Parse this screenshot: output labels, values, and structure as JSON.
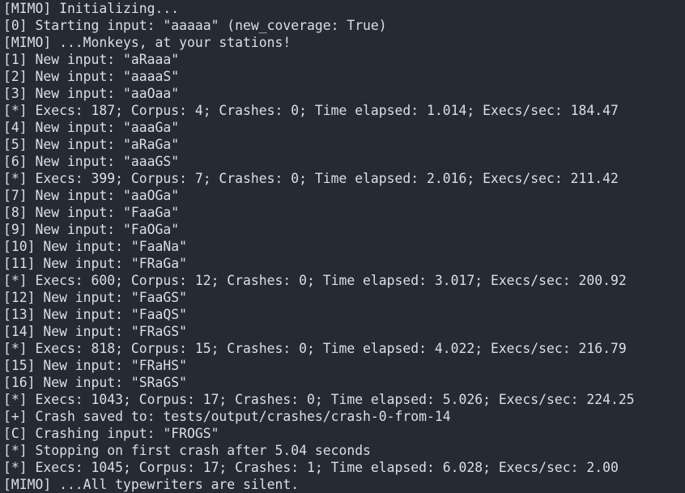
{
  "terminal": {
    "lines": [
      "[MIMO] Initializing...",
      "[0] Starting input: \"aaaaa\" (new_coverage: True)",
      "[MIMO] ...Monkeys, at your stations!",
      "[1] New input: \"aRaaa\"",
      "[2] New input: \"aaaaS\"",
      "[3] New input: \"aaOaa\"",
      "[*] Execs: 187; Corpus: 4; Crashes: 0; Time elapsed: 1.014; Execs/sec: 184.47",
      "[4] New input: \"aaaGa\"",
      "[5] New input: \"aRaGa\"",
      "[6] New input: \"aaaGS\"",
      "[*] Execs: 399; Corpus: 7; Crashes: 0; Time elapsed: 2.016; Execs/sec: 211.42",
      "[7] New input: \"aaOGa\"",
      "[8] New input: \"FaaGa\"",
      "[9] New input: \"FaOGa\"",
      "[10] New input: \"FaaNa\"",
      "[11] New input: \"FRaGa\"",
      "[*] Execs: 600; Corpus: 12; Crashes: 0; Time elapsed: 3.017; Execs/sec: 200.92",
      "[12] New input: \"FaaGS\"",
      "[13] New input: \"FaaQS\"",
      "[14] New input: \"FRaGS\"",
      "[*] Execs: 818; Corpus: 15; Crashes: 0; Time elapsed: 4.022; Execs/sec: 216.79",
      "[15] New input: \"FRaHS\"",
      "[16] New input: \"SRaGS\"",
      "[*] Execs: 1043; Corpus: 17; Crashes: 0; Time elapsed: 5.026; Execs/sec: 224.25",
      "[+] Crash saved to: tests/output/crashes/crash-0-from-14",
      "[C] Crashing input: \"FROGS\"",
      "[*] Stopping on first crash after 5.04 seconds",
      "[*] Execs: 1045; Corpus: 17; Crashes: 1; Time elapsed: 6.028; Execs/sec: 2.00",
      "[MIMO] ...All typewriters are silent."
    ]
  }
}
